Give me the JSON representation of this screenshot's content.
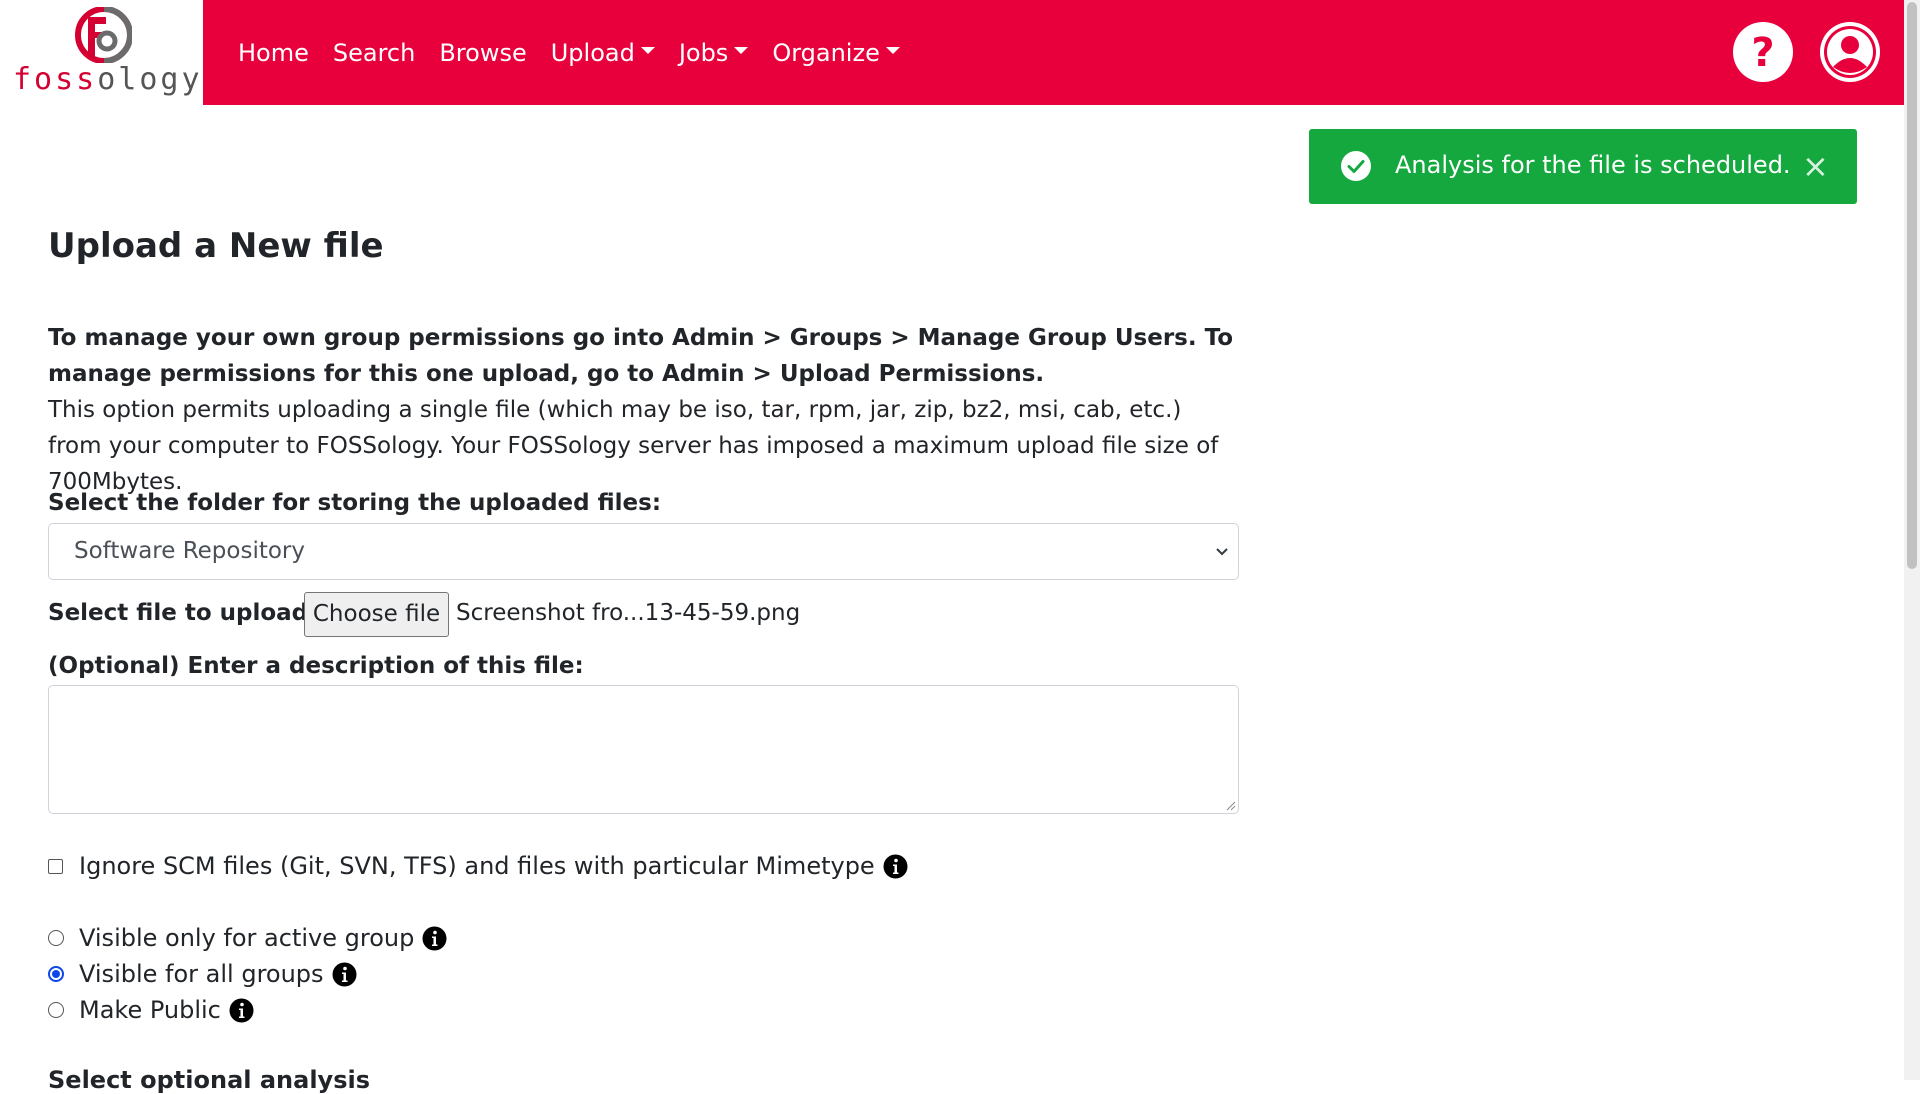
{
  "logo": {
    "text_red": "foss",
    "text_grey": "ology"
  },
  "nav": {
    "items": [
      {
        "label": "Home",
        "dropdown": false
      },
      {
        "label": "Search",
        "dropdown": false
      },
      {
        "label": "Browse",
        "dropdown": false
      },
      {
        "label": "Upload",
        "dropdown": true
      },
      {
        "label": "Jobs",
        "dropdown": true
      },
      {
        "label": "Organize",
        "dropdown": true
      }
    ],
    "icons": [
      "help-icon",
      "user-icon"
    ]
  },
  "toast": {
    "message": "Analysis for the file is scheduled.",
    "close": "×",
    "color": "#14a83e"
  },
  "page": {
    "title": "Upload a New file",
    "bold_note": "To manage your own group permissions go into Admin > Groups > Manage Group Users. To manage permissions for this one upload, go to Admin > Upload Permissions.",
    "description": "This option permits uploading a single file (which may be iso, tar, rpm, jar, zip, bz2, msi, cab, etc.) from your computer to FOSSology. Your FOSSology server has imposed a maximum upload file size of 700Mbytes."
  },
  "form": {
    "folder_label": "Select the folder for storing the uploaded files:",
    "folder_value": "Software Repository",
    "file_label": "Select file to upload:",
    "choose_file": "Choose file",
    "file_name": "Screenshot fro...13-45-59.png",
    "desc_label": "(Optional) Enter a description of this file:",
    "desc_value": "",
    "ignore_scm": "Ignore SCM files (Git, SVN, TFS) and files with particular Mimetype",
    "ignore_scm_checked": false,
    "visibility": [
      {
        "label": "Visible only for active group",
        "checked": false
      },
      {
        "label": "Visible for all groups",
        "checked": true
      },
      {
        "label": "Make Public",
        "checked": false
      }
    ],
    "next_heading": "Select optional analysis"
  },
  "colors": {
    "brand": "#e8003d",
    "radio_accent": "#0d47e8"
  }
}
